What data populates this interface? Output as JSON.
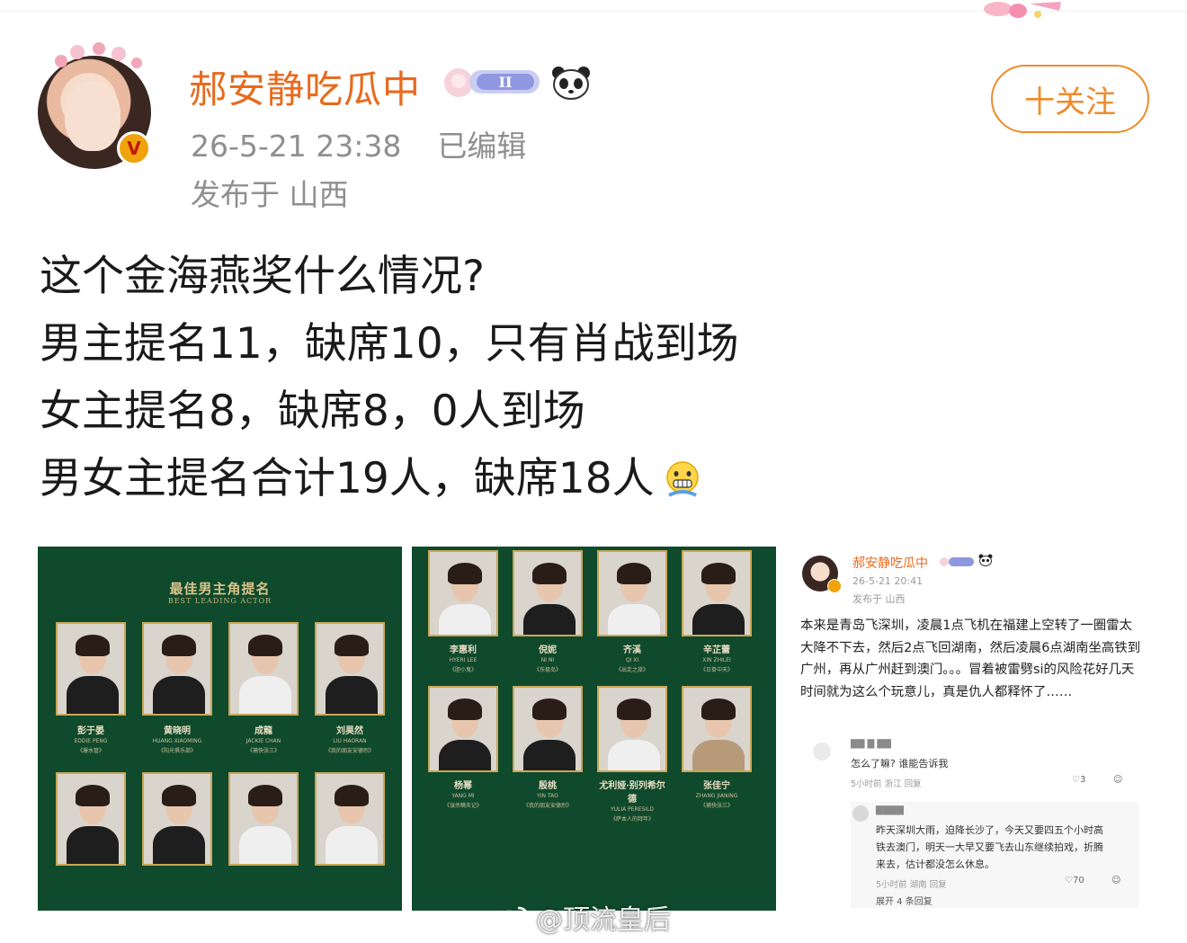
{
  "header": {
    "username": "郝安静吃瓜中",
    "timestamp": "26-5-21 23:38",
    "edited": "已编辑",
    "location": "发布于 山西",
    "follow_label": "十关注"
  },
  "post": {
    "lines": [
      "这个金海燕奖什么情况?",
      "男主提名11，缺席10，只有肖战到场",
      "女主提名8，缺席8，0人到场",
      "男女主提名合计19人，缺席18人"
    ]
  },
  "images": {
    "poster1": {
      "title": "最佳男主角提名",
      "subtitle": "BEST LEADING ACTOR",
      "nominees": [
        {
          "cn": "彭于晏",
          "en": "EDDIE PENG",
          "film": "《爆水管》"
        },
        {
          "cn": "黄晓明",
          "en": "HUANG XIAOMING",
          "film": "《阳光俱乐部》"
        },
        {
          "cn": "成龍",
          "en": "JACKIE CHAN",
          "film": "《捕快张三》"
        },
        {
          "cn": "刘昊然",
          "en": "LIU HAORAN",
          "film": "《我的朋友安德烈》"
        },
        {
          "cn": "",
          "en": "",
          "film": ""
        },
        {
          "cn": "",
          "en": "",
          "film": ""
        },
        {
          "cn": "",
          "en": "",
          "film": ""
        },
        {
          "cn": "",
          "en": "",
          "film": ""
        }
      ]
    },
    "poster2": {
      "nominees": [
        {
          "cn": "李惠利",
          "en": "HYERI LEE",
          "film": "《胆小鬼》"
        },
        {
          "cn": "倪妮",
          "en": "NI NI",
          "film": "《东极岛》"
        },
        {
          "cn": "齐溪",
          "en": "QI XI",
          "film": "《出走之旅》"
        },
        {
          "cn": "辛芷蕾",
          "en": "XIN ZHILEI",
          "film": "《日掛中天》"
        },
        {
          "cn": "杨幂",
          "en": "YANG MI",
          "film": "《误杀瞒天记》"
        },
        {
          "cn": "殷桃",
          "en": "YIN TAO",
          "film": "《我的朋友安德烈》"
        },
        {
          "cn": "尤利娅·别列希尔德",
          "en": "YULIA PERESILD",
          "film": "《萨本人的拜年》"
        },
        {
          "cn": "张佳宁",
          "en": "ZHANG JIANING",
          "film": "《捕快张三》"
        }
      ]
    },
    "screenshot": {
      "username": "郝安静吃瓜中",
      "timestamp": "26-5-21 20:41",
      "location": "发布于 山西",
      "body": "本来是青岛飞深圳，凌晨1点飞机在福建上空转了一圈雷太大降不下去，然后2点飞回湖南，然后凌晨6点湖南坐高铁到广州，再从广州赶到澳门。。。冒着被雷劈si的风险花好几天时间就为这么个玩意儿，真是仇人都释怀了……",
      "comment1": {
        "text": "怎么了嘛? 谁能告诉我",
        "meta": "5小时前 浙江  回复",
        "likes": "3"
      },
      "comment2": {
        "text_lines": [
          "昨天深圳大雨，迫降长沙了，今天又要四五个小时高",
          "铁去澳门，明天一大早又要飞去山东继续拍戏，折腾",
          "来去，估计都没怎么休息。"
        ],
        "meta": "5小时前 湖南  回复",
        "likes": "70"
      },
      "more_replies": "展开 4 条回复"
    }
  },
  "watermark": "@顶流皇后",
  "colors": {
    "username": "#e86a1d",
    "follow": "#f08b2a",
    "meta_gray": "#8f8f8f",
    "poster_green": "#0f4a2c",
    "poster_gold": "#caa757"
  }
}
